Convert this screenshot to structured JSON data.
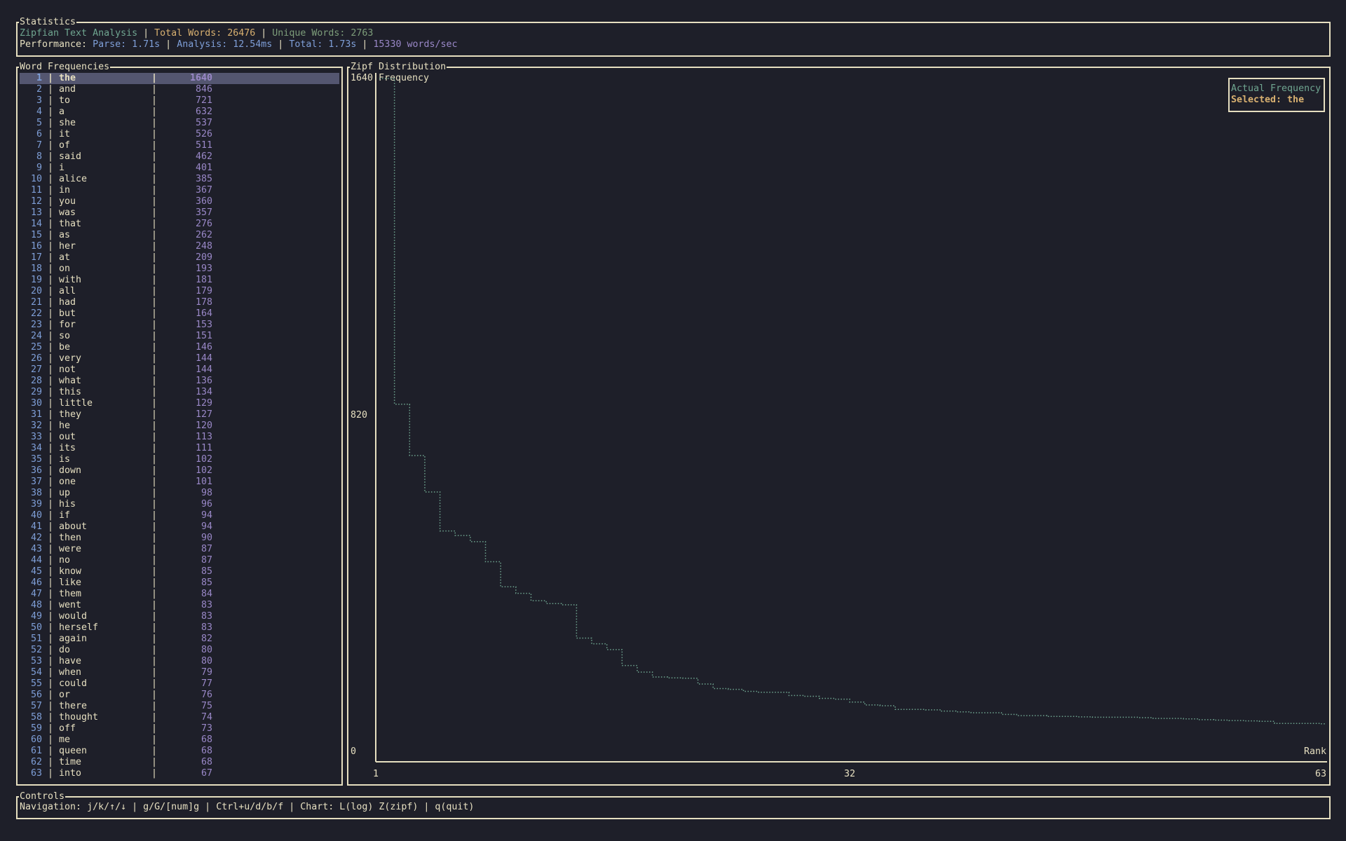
{
  "statistics": {
    "title": "Statistics",
    "app_name": "Zipfian Text Analysis",
    "sep": " | ",
    "total_words": "Total Words: 26476",
    "unique_words": "Unique Words: 2763",
    "perf_label": "Performance: ",
    "parse": "Parse: 1.71s",
    "analysis": "Analysis: 12.54ms",
    "total": "Total: 1.73s",
    "rate": "15330 words/sec"
  },
  "word_list": {
    "title": "Word Frequencies",
    "selected_index": 0,
    "rows": [
      [
        "1",
        "the",
        "1640"
      ],
      [
        "2",
        "and",
        "846"
      ],
      [
        "3",
        "to",
        "721"
      ],
      [
        "4",
        "a",
        "632"
      ],
      [
        "5",
        "she",
        "537"
      ],
      [
        "6",
        "it",
        "526"
      ],
      [
        "7",
        "of",
        "511"
      ],
      [
        "8",
        "said",
        "462"
      ],
      [
        "9",
        "i",
        "401"
      ],
      [
        "10",
        "alice",
        "385"
      ],
      [
        "11",
        "in",
        "367"
      ],
      [
        "12",
        "you",
        "360"
      ],
      [
        "13",
        "was",
        "357"
      ],
      [
        "14",
        "that",
        "276"
      ],
      [
        "15",
        "as",
        "262"
      ],
      [
        "16",
        "her",
        "248"
      ],
      [
        "17",
        "at",
        "209"
      ],
      [
        "18",
        "on",
        "193"
      ],
      [
        "19",
        "with",
        "181"
      ],
      [
        "20",
        "all",
        "179"
      ],
      [
        "21",
        "had",
        "178"
      ],
      [
        "22",
        "but",
        "164"
      ],
      [
        "23",
        "for",
        "153"
      ],
      [
        "24",
        "so",
        "151"
      ],
      [
        "25",
        "be",
        "146"
      ],
      [
        "26",
        "very",
        "144"
      ],
      [
        "27",
        "not",
        "144"
      ],
      [
        "28",
        "what",
        "136"
      ],
      [
        "29",
        "this",
        "134"
      ],
      [
        "30",
        "little",
        "129"
      ],
      [
        "31",
        "they",
        "127"
      ],
      [
        "32",
        "he",
        "120"
      ],
      [
        "33",
        "out",
        "113"
      ],
      [
        "34",
        "its",
        "111"
      ],
      [
        "35",
        "is",
        "102"
      ],
      [
        "36",
        "down",
        "102"
      ],
      [
        "37",
        "one",
        "101"
      ],
      [
        "38",
        "up",
        "98"
      ],
      [
        "39",
        "his",
        "96"
      ],
      [
        "40",
        "if",
        "94"
      ],
      [
        "41",
        "about",
        "94"
      ],
      [
        "42",
        "then",
        "90"
      ],
      [
        "43",
        "were",
        "87"
      ],
      [
        "44",
        "no",
        "87"
      ],
      [
        "45",
        "know",
        "85"
      ],
      [
        "46",
        "like",
        "85"
      ],
      [
        "47",
        "them",
        "84"
      ],
      [
        "48",
        "went",
        "83"
      ],
      [
        "49",
        "would",
        "83"
      ],
      [
        "50",
        "herself",
        "83"
      ],
      [
        "51",
        "again",
        "82"
      ],
      [
        "52",
        "do",
        "80"
      ],
      [
        "53",
        "have",
        "80"
      ],
      [
        "54",
        "when",
        "79"
      ],
      [
        "55",
        "could",
        "77"
      ],
      [
        "56",
        "or",
        "76"
      ],
      [
        "57",
        "there",
        "75"
      ],
      [
        "58",
        "thought",
        "74"
      ],
      [
        "59",
        "off",
        "73"
      ],
      [
        "60",
        "me",
        "68"
      ],
      [
        "61",
        "queen",
        "68"
      ],
      [
        "62",
        "time",
        "68"
      ],
      [
        "63",
        "into",
        "67"
      ]
    ]
  },
  "chart": {
    "title": "Zipf Distribution",
    "legend_actual": "Actual Frequency",
    "legend_selected": "Selected: the",
    "line_color": "#6fa590"
  },
  "chart_data": {
    "type": "line",
    "title": "Zipf Distribution",
    "xlabel": "Rank",
    "ylabel": "Frequency",
    "xlim": [
      1,
      63
    ],
    "ylim": [
      0,
      1640
    ],
    "x_ticks": [
      "1",
      "32",
      "63"
    ],
    "y_ticks": [
      "0",
      "820",
      "1640"
    ],
    "x": [
      1,
      2,
      3,
      4,
      5,
      6,
      7,
      8,
      9,
      10,
      11,
      12,
      13,
      14,
      15,
      16,
      17,
      18,
      19,
      20,
      21,
      22,
      23,
      24,
      25,
      26,
      27,
      28,
      29,
      30,
      31,
      32,
      33,
      34,
      35,
      36,
      37,
      38,
      39,
      40,
      41,
      42,
      43,
      44,
      45,
      46,
      47,
      48,
      49,
      50,
      51,
      52,
      53,
      54,
      55,
      56,
      57,
      58,
      59,
      60,
      61,
      62,
      63
    ],
    "y": [
      1640,
      846,
      721,
      632,
      537,
      526,
      511,
      462,
      401,
      385,
      367,
      360,
      357,
      276,
      262,
      248,
      209,
      193,
      181,
      179,
      178,
      164,
      153,
      151,
      146,
      144,
      144,
      136,
      134,
      129,
      127,
      120,
      113,
      111,
      102,
      102,
      101,
      98,
      96,
      94,
      94,
      90,
      87,
      87,
      85,
      85,
      84,
      83,
      83,
      83,
      82,
      80,
      80,
      79,
      77,
      76,
      75,
      74,
      73,
      68,
      68,
      68,
      67
    ]
  },
  "controls": {
    "title": "Controls",
    "text": "Navigation: j/k/↑/↓ | g/G/[num]g | Ctrl+u/d/b/f | Chart: L(log) Z(zipf) | q(quit)"
  }
}
